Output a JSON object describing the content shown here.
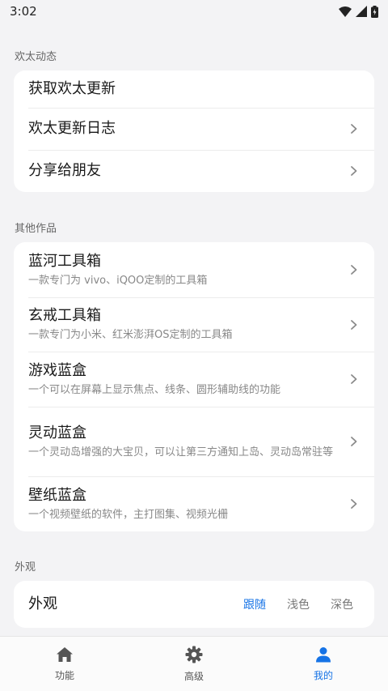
{
  "status": {
    "time": "3:02"
  },
  "sections": {
    "news": {
      "title": "欢太动态",
      "items": [
        {
          "title": "获取欢太更新"
        },
        {
          "title": "欢太更新日志"
        },
        {
          "title": "分享给朋友"
        }
      ]
    },
    "works": {
      "title": "其他作品",
      "items": [
        {
          "title": "蓝河工具箱",
          "subtitle": "一款专门为 vivo、iQOO定制的工具箱"
        },
        {
          "title": "玄戒工具箱",
          "subtitle": "一款专门为小米、红米澎湃OS定制的工具箱"
        },
        {
          "title": "游戏蓝盒",
          "subtitle": "一个可以在屏幕上显示焦点、线条、圆形辅助线的功能"
        },
        {
          "title": "灵动蓝盒",
          "subtitle": "一个灵动岛增强的大宝贝，可以让第三方通知上岛、灵动岛常驻等"
        },
        {
          "title": "壁纸蓝盒",
          "subtitle": "一个视频壁纸的软件，主打图集、视频光栅"
        }
      ]
    },
    "appearance": {
      "title": "外观",
      "row_label": "外观",
      "options": [
        "跟随",
        "浅色",
        "深色"
      ],
      "selected": "跟随"
    }
  },
  "bottom_nav": [
    {
      "label": "功能",
      "icon": "home-icon"
    },
    {
      "label": "高级",
      "icon": "gear-icon"
    },
    {
      "label": "我的",
      "icon": "person-icon",
      "active": true
    }
  ],
  "colors": {
    "accent": "#1673e6",
    "background": "#f3f3f5"
  }
}
